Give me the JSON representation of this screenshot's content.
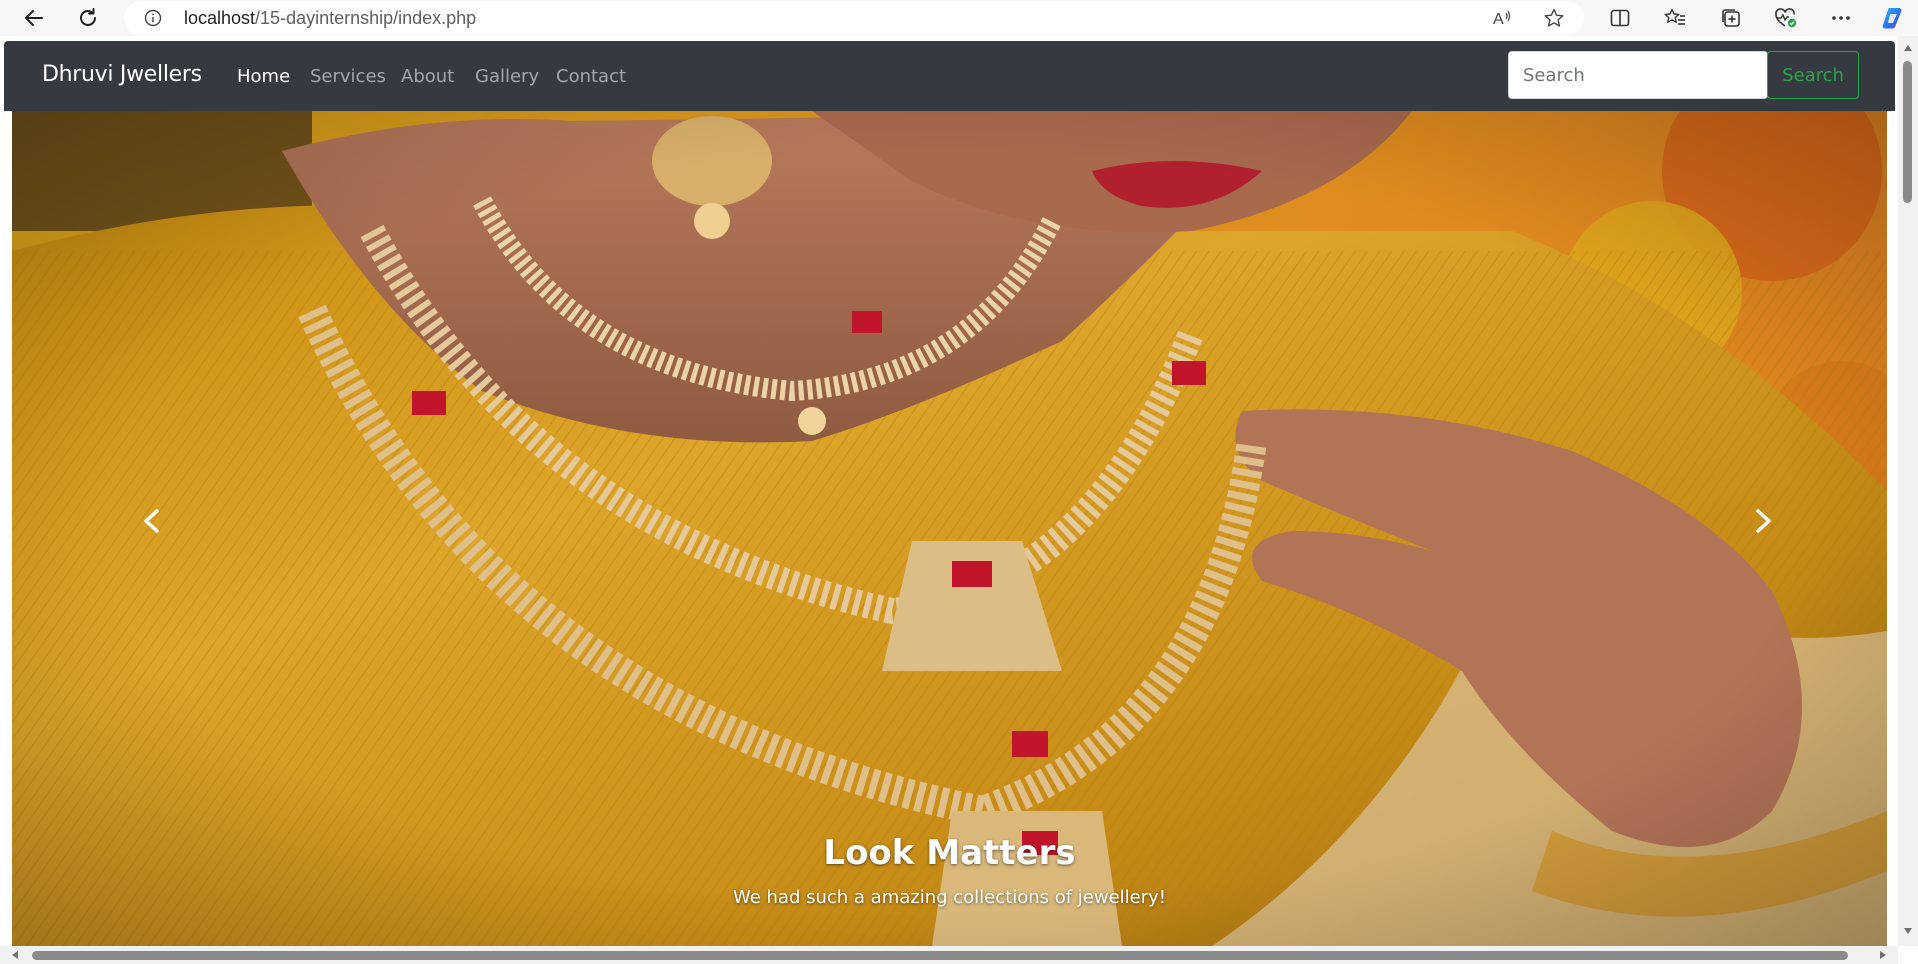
{
  "browser": {
    "url_host": "localhost",
    "url_path": "/15-dayinternship/index.php",
    "reader_label": "A"
  },
  "navbar": {
    "brand": "Dhruvi Jwellers",
    "links": [
      "Home",
      "Services",
      "About",
      "Gallery",
      "Contact"
    ],
    "active_index": 0,
    "search_placeholder": "Search",
    "search_button": "Search"
  },
  "carousel": {
    "caption_title": "Look Matters",
    "caption_text": "We had such a amazing collections of jewellery!"
  },
  "colors": {
    "navbar_bg": "#343a40",
    "search_button": "#28a745",
    "saree_gold": "#d9a21b"
  },
  "icons": {
    "back": "arrow-left-icon",
    "reload": "reload-icon",
    "site_info": "info-icon",
    "read_aloud": "read-aloud-icon",
    "favorite": "star-icon",
    "split_screen": "split-screen-icon",
    "favorites": "favorites-icon",
    "collections": "collections-icon",
    "browser_essentials": "heart-pulse-icon",
    "more": "more-icon",
    "copilot": "copilot-icon",
    "prev": "chevron-left-icon",
    "next": "chevron-right-icon"
  }
}
